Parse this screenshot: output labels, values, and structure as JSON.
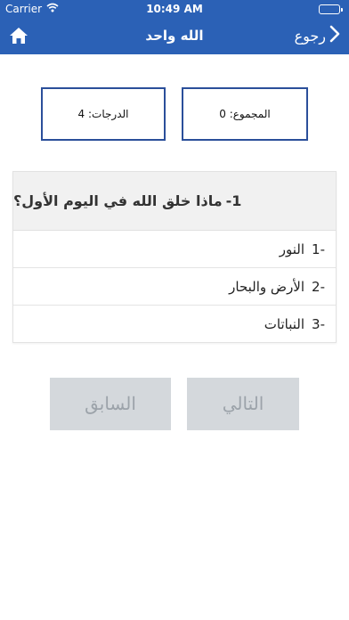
{
  "status_bar": {
    "carrier": "Carrier",
    "time": "10:49 AM"
  },
  "nav": {
    "title": "الله واحد",
    "back_label": "رجوع",
    "back_icon": "chevron-left-icon",
    "home_icon": "home-icon"
  },
  "scores": {
    "total": "المجموع: 0",
    "grades": "الدرجات: 4"
  },
  "question": {
    "number": "1-",
    "text": "ماذا خلق الله في اليوم الأول؟",
    "answers": [
      {
        "number": "-1",
        "text": "النور"
      },
      {
        "number": "-2",
        "text": "الأرض والبحار"
      },
      {
        "number": "-3",
        "text": "النباتات"
      }
    ]
  },
  "buttons": {
    "next": "التالي",
    "previous": "السابق"
  },
  "colors": {
    "accent": "#2b61b6",
    "box_border": "#2b4f9a",
    "button_bg": "#d4d8dc",
    "button_text": "#9ca3aa"
  }
}
